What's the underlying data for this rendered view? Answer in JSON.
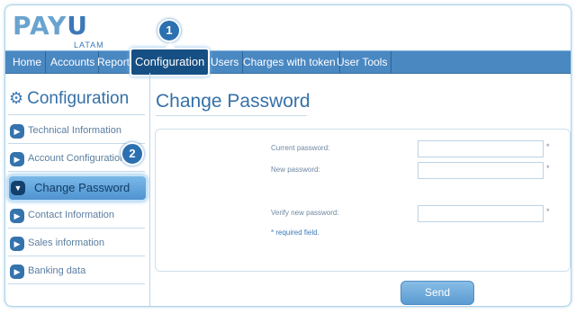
{
  "logo": {
    "text_main": "PAY",
    "text_u": "U",
    "sub": "LATAM"
  },
  "nav": {
    "items": [
      "Home",
      "Accounts",
      "Reports",
      "Configuration",
      "Users",
      "Charges with token",
      "User Tools"
    ]
  },
  "badges": {
    "one": "1",
    "two": "2"
  },
  "sidebar": {
    "title": "Configuration",
    "items": [
      "Technical Information",
      "Account Configuration",
      "Change Password",
      "Contact Information",
      "Sales information",
      "Banking data"
    ]
  },
  "main": {
    "title": "Change Password",
    "current_password_label": "Current password:",
    "new_password_label": "New password:",
    "verify_password_label": "Verify new password:",
    "required_star": "*",
    "required_note": "* required field.",
    "send_label": "Send"
  },
  "colors": {
    "accent": "#4a88c2",
    "dark_accent": "#164f83"
  }
}
